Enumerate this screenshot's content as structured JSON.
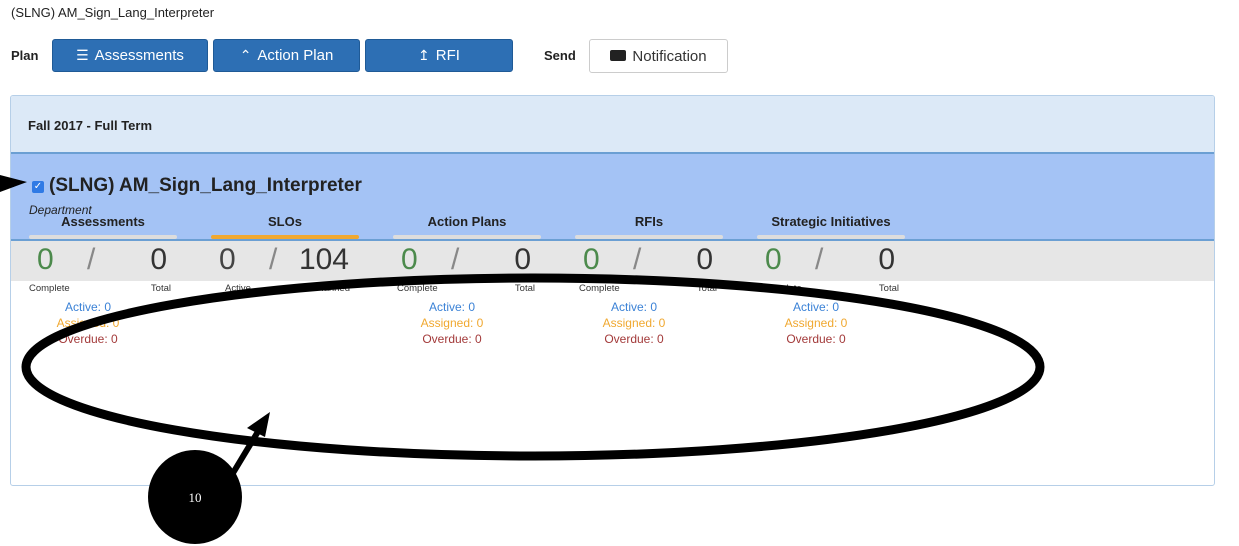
{
  "breadcrumb": "(SLNG) AM_Sign_Lang_Interpreter",
  "toolbar": {
    "plan_label": "Plan",
    "assessments_label": "Assessments",
    "action_plan_label": "Action Plan",
    "rfi_label": "RFI",
    "send_label": "Send",
    "notification_label": "Notification"
  },
  "panel": {
    "term": "Fall 2017 - Full Term",
    "dept_name": "(SLNG) AM_Sign_Lang_Interpreter",
    "dept_type": "Department"
  },
  "stats": [
    {
      "title": "Assessments",
      "a": "0",
      "b": "0",
      "la": "Complete",
      "lb": "Total",
      "active": "Active: 0",
      "assigned": "Assigned: 0",
      "overdue": "Overdue: 0"
    },
    {
      "title": "SLOs",
      "a": "0",
      "b": "104",
      "la": "Active",
      "lb": "Planned"
    },
    {
      "title": "Action Plans",
      "a": "0",
      "b": "0",
      "la": "Complete",
      "lb": "Total",
      "active": "Active: 0",
      "assigned": "Assigned: 0",
      "overdue": "Overdue: 0"
    },
    {
      "title": "RFIs",
      "a": "0",
      "b": "0",
      "la": "Complete",
      "lb": "Total",
      "active": "Active: 0",
      "assigned": "Assigned: 0",
      "overdue": "Overdue: 0"
    },
    {
      "title": "Strategic Initiatives",
      "a": "0",
      "b": "0",
      "la": "Complete",
      "lb": "Total",
      "active": "Active: 0",
      "assigned": "Assigned: 0",
      "overdue": "Overdue: 0"
    }
  ],
  "callout_number": "10",
  "colors": {
    "primary_button": "#2d6fb4",
    "dept_highlight": "#a4c3f5",
    "active_tab": "#f0a830"
  }
}
